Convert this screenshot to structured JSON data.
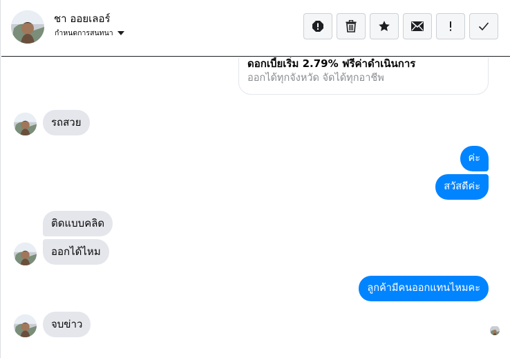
{
  "header": {
    "contact_name": "ชา ออยเลอร์",
    "contact_sub": "กำหนดการสนทนา",
    "actions": [
      {
        "icon": "alert-circle-icon",
        "name": "report-button"
      },
      {
        "icon": "trash-icon",
        "name": "delete-button"
      },
      {
        "icon": "star-icon",
        "name": "star-button"
      },
      {
        "icon": "envelope-icon",
        "name": "mark-unread-button"
      },
      {
        "icon": "exclamation-icon",
        "name": "spam-button"
      },
      {
        "icon": "checkmark-icon",
        "name": "done-button"
      }
    ]
  },
  "card": {
    "title": "ดอกเบี้ยเริ่ม 2.79% ฟรีค่าดำเนินการ",
    "subtitle": "ออกได้ทุกจังหวัด จัดได้ทุกอาชีพ"
  },
  "messages": [
    {
      "direction": "incoming",
      "text": "รถสวย"
    },
    {
      "direction": "outgoing",
      "text": "ค่ะ"
    },
    {
      "direction": "outgoing",
      "text": "สวัสดีค่ะ"
    },
    {
      "direction": "incoming",
      "text": "ติดแบบคลิด"
    },
    {
      "direction": "incoming",
      "text": "ออกได้ไหม"
    },
    {
      "direction": "outgoing",
      "text": "ลูกค้ามีคนออกแทนไหมคะ"
    },
    {
      "direction": "incoming",
      "text": "จบข่าว"
    }
  ],
  "colors": {
    "outgoing_bubble": "#0084ff",
    "incoming_bubble": "#e4e6eb",
    "button_bg": "#f5f6f7"
  }
}
